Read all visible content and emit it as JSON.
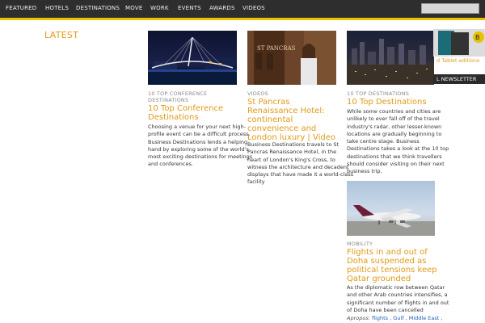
{
  "nav": {
    "items": [
      "FEATURED",
      "HOTELS",
      "DESTINATIONS",
      "MOVE",
      "WORK",
      "EVENTS",
      "AWARDS",
      "VIDEOS"
    ]
  },
  "section_title": "LATEST",
  "sidebar": {
    "tablet_label": "d Tablet editions",
    "newsletter_label": "L NEWSLETTER"
  },
  "cards": [
    {
      "category": "10 TOP CONFERENCE DESTINATIONS",
      "category_line1": "10 TOP CONFERENCE",
      "category_line2": "DESTINATIONS",
      "title_line1": "10 Top Conference",
      "title_line2": "Destinations",
      "desc_lines": [
        "Choosing a venue for your next high-",
        "profile event can be a difficult process.",
        "Business Destinations lends a helping",
        "hand by exploring some of the world's",
        "most exciting destinations for meetings",
        "and conferences."
      ]
    },
    {
      "category": "VIDEOS",
      "title_lines": [
        "St Pancras",
        "Renaissance Hotel:",
        "continental",
        "convenience and",
        "London luxury | Video"
      ],
      "desc_lines": [
        "Business Destinations travels to St",
        "Pancras Renaissance Hotel, in the",
        "heart of London's King's Cross, to",
        "witness the architecture and decadent",
        "displays that have made it a world-class",
        "facility"
      ]
    },
    {
      "category": "10 TOP DESTINATIONS",
      "title": "10 Top Destinations",
      "desc_lines": [
        "While some countries and cities are",
        "unlikely to ever fall off of the travel",
        "industry's radar, other lesser-known",
        "locations are gradually beginning to",
        "take centre stage. Business",
        "Destinations takes a look at the 10 top",
        "destinations that we think travellers",
        "should consider visiting on their next",
        "business trip."
      ]
    },
    {
      "category": "MOBILITY",
      "title_lines": [
        "Flights in and out of",
        "Doha suspended as",
        "political tensions keep",
        "Qatar grounded"
      ],
      "desc_lines": [
        "As the diplomatic row between Qatar",
        "and other Arab countries intensifies, a",
        "significant number of flights in and out",
        "of Doha have been cancelled"
      ],
      "apropos_label": "Apropos:",
      "tags": [
        "flights",
        "Gulf",
        "Middle East"
      ]
    }
  ],
  "colors": {
    "accent": "#e09a16",
    "nav_bg": "#2e2e2e",
    "nav_border": "#e8c200",
    "link": "#1c5fb3"
  }
}
